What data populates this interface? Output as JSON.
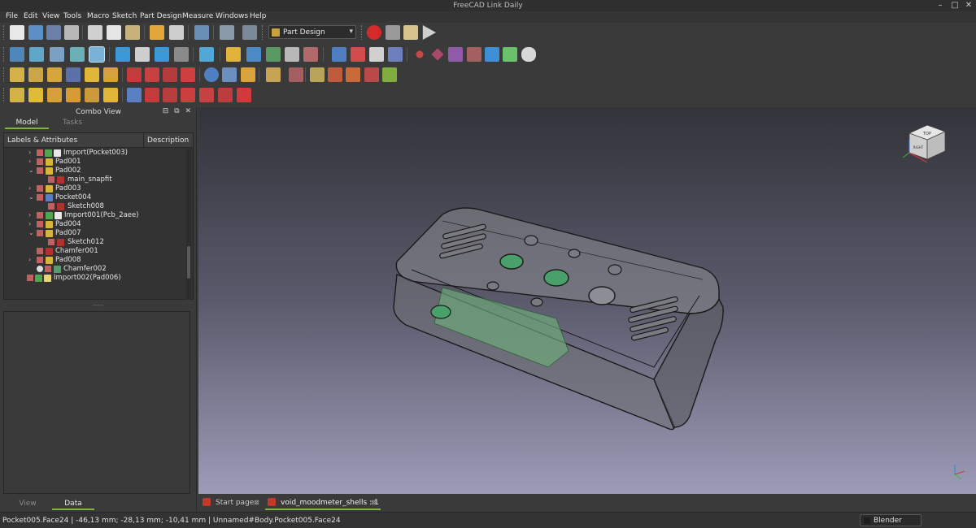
{
  "window": {
    "title": "FreeCAD Link Daily",
    "minimize": "–",
    "maximize": "□",
    "close": "✕"
  },
  "menubar": {
    "items": [
      "File",
      "Edit",
      "View",
      "Tools",
      "Macro",
      "Sketch",
      "Part Design",
      "Measure",
      "Windows",
      "Help"
    ]
  },
  "toolbar": {
    "workbench": "Part Design",
    "workbench_arrow": "▾"
  },
  "combo_view": {
    "title": "Combo View",
    "buttons": [
      "⊟",
      "⧉",
      "✕"
    ],
    "tabs": [
      "Model",
      "Tasks"
    ],
    "tree_headers": [
      "Labels & Attributes",
      "Description"
    ],
    "splitter": "-----",
    "bottom_tabs": [
      "View",
      "Data"
    ]
  },
  "tree": [
    {
      "label": "Import(Pocket003)",
      "expand": "›"
    },
    {
      "label": "Pad001",
      "expand": "›"
    },
    {
      "label": "Pad002",
      "expand": "⌄"
    },
    {
      "label": "main_snapfit",
      "expand": ""
    },
    {
      "label": "Pad003",
      "expand": "›"
    },
    {
      "label": "Pocket004",
      "expand": "⌄"
    },
    {
      "label": "Sketch008",
      "expand": ""
    },
    {
      "label": "Import001(Pcb_2aee)",
      "expand": "›"
    },
    {
      "label": "Pad004",
      "expand": "›"
    },
    {
      "label": "Pad007",
      "expand": "⌄"
    },
    {
      "label": "Sketch012",
      "expand": ""
    },
    {
      "label": "Chamfer001",
      "expand": ""
    },
    {
      "label": "Pad008",
      "expand": "›"
    },
    {
      "label": "Chamfer002",
      "expand": ""
    },
    {
      "label": "Import002(Pad006)",
      "expand": ""
    }
  ],
  "nav_cube": {
    "top": "TOP",
    "front": "RIGHT"
  },
  "doc_tabs": [
    {
      "label": "Start page",
      "close": "⊠"
    },
    {
      "label": "void_moodmeter_shells : 1",
      "close": "⊠"
    }
  ],
  "statusbar": {
    "text": "Pocket005.Face24 | -46,13 mm; -28,13 mm; -10,41 mm | Unnamed#Body.Pocket005.Face24",
    "nav_style": "Blender"
  },
  "colors": {
    "accent_green": "#7fb341",
    "viewport_top": "#33333a",
    "viewport_bottom": "#9c9cb8"
  }
}
